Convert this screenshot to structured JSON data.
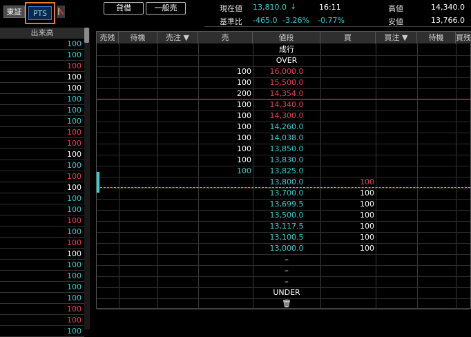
{
  "markets": {
    "tosho": "東証",
    "pts": "PTS"
  },
  "toolbar": {
    "credit": "貸借",
    "general": "一般売"
  },
  "quote": {
    "current_label": "現在値",
    "current_value": "13,810.0",
    "current_arrow": "↓",
    "time": "16:11",
    "base_label": "基準比",
    "base_change": "-465.0",
    "base_pct": "-3.26%",
    "pct2": "-0.77%",
    "high_label": "高値",
    "high_value": "14,340.0",
    "low_label": "安値",
    "low_value": "13,766.0"
  },
  "left_list": {
    "header": "出来高",
    "rows": [
      {
        "v": "100",
        "c": "cyan"
      },
      {
        "v": "100",
        "c": "cyan"
      },
      {
        "v": "100",
        "c": "red"
      },
      {
        "v": "100",
        "c": "white"
      },
      {
        "v": "100",
        "c": "white"
      },
      {
        "v": "100",
        "c": "cyan"
      },
      {
        "v": "100",
        "c": "cyan"
      },
      {
        "v": "100",
        "c": "cyan"
      },
      {
        "v": "100",
        "c": "red"
      },
      {
        "v": "100",
        "c": "red"
      },
      {
        "v": "100",
        "c": "white"
      },
      {
        "v": "100",
        "c": "cyan"
      },
      {
        "v": "100",
        "c": "red"
      },
      {
        "v": "100",
        "c": "white"
      },
      {
        "v": "100",
        "c": "cyan"
      },
      {
        "v": "100",
        "c": "cyan"
      },
      {
        "v": "100",
        "c": "red"
      },
      {
        "v": "100",
        "c": "cyan"
      },
      {
        "v": "100",
        "c": "red"
      },
      {
        "v": "100",
        "c": "white"
      },
      {
        "v": "100",
        "c": "cyan"
      },
      {
        "v": "100",
        "c": "cyan"
      },
      {
        "v": "100",
        "c": "cyan"
      },
      {
        "v": "100",
        "c": "cyan"
      },
      {
        "v": "100",
        "c": "red"
      },
      {
        "v": "100",
        "c": "red"
      },
      {
        "v": "100",
        "c": "cyan"
      }
    ]
  },
  "board": {
    "headers": [
      "売残",
      "待機",
      "売注 ▼",
      "売",
      "値段",
      "買",
      "買注 ▼",
      "待機",
      "買残"
    ],
    "rows": [
      {
        "price": "成行",
        "pc": "white",
        "sell": "",
        "buy": "",
        "bc": "white"
      },
      {
        "price": "OVER",
        "pc": "white",
        "sell": "",
        "buy": "",
        "bc": "white"
      },
      {
        "price": "16,000.0",
        "pc": "red",
        "sell": "100",
        "buy": "",
        "bc": "white"
      },
      {
        "price": "15,500.0",
        "pc": "red",
        "sell": "100",
        "buy": "",
        "bc": "white"
      },
      {
        "price": "14,354.0",
        "pc": "red",
        "sell": "200",
        "buy": "",
        "bc": "white"
      },
      {
        "price": "14,340.0",
        "pc": "red",
        "sell": "100",
        "buy": "",
        "bc": "white"
      },
      {
        "price": "14,300.0",
        "pc": "red",
        "sell": "100",
        "buy": "",
        "bc": "white"
      },
      {
        "price": "14,260.0",
        "pc": "cyan",
        "sell": "100",
        "buy": "",
        "bc": "white"
      },
      {
        "price": "14,038.0",
        "pc": "cyan",
        "sell": "100",
        "buy": "",
        "bc": "white"
      },
      {
        "price": "13,850.0",
        "pc": "cyan",
        "sell": "100",
        "buy": "",
        "bc": "white"
      },
      {
        "price": "13,830.0",
        "pc": "cyan",
        "sell": "100",
        "buy": "",
        "bc": "white"
      },
      {
        "price": "13,825.0",
        "pc": "cyan",
        "sell": "100",
        "buy": "",
        "bc": "white",
        "sc": "cyan"
      },
      {
        "price": "13,800.0",
        "pc": "cyan",
        "sell": "",
        "buy": "100",
        "bc": "red"
      },
      {
        "price": "13,700.0",
        "pc": "cyan",
        "sell": "",
        "buy": "100",
        "bc": "white"
      },
      {
        "price": "13,699.5",
        "pc": "cyan",
        "sell": "",
        "buy": "100",
        "bc": "white"
      },
      {
        "price": "13,500.0",
        "pc": "cyan",
        "sell": "",
        "buy": "100",
        "bc": "white"
      },
      {
        "price": "13,117.5",
        "pc": "cyan",
        "sell": "",
        "buy": "100",
        "bc": "white"
      },
      {
        "price": "13,100.5",
        "pc": "cyan",
        "sell": "",
        "buy": "100",
        "bc": "white"
      },
      {
        "price": "13,000.0",
        "pc": "cyan",
        "sell": "",
        "buy": "100",
        "bc": "white"
      },
      {
        "price": "–",
        "pc": "white",
        "sell": "",
        "buy": "",
        "bc": "white"
      },
      {
        "price": "–",
        "pc": "white",
        "sell": "",
        "buy": "",
        "bc": "white"
      },
      {
        "price": "–",
        "pc": "white",
        "sell": "",
        "buy": "",
        "bc": "white"
      },
      {
        "price": "UNDER",
        "pc": "white",
        "sell": "",
        "buy": "",
        "bc": "white"
      },
      {
        "price": "🗑",
        "pc": "white",
        "sell": "",
        "buy": "",
        "bc": "white"
      }
    ]
  },
  "colors": {
    "cyan": "#2ad4d4",
    "red": "#f03c5a",
    "accent": "#f07a1a"
  }
}
